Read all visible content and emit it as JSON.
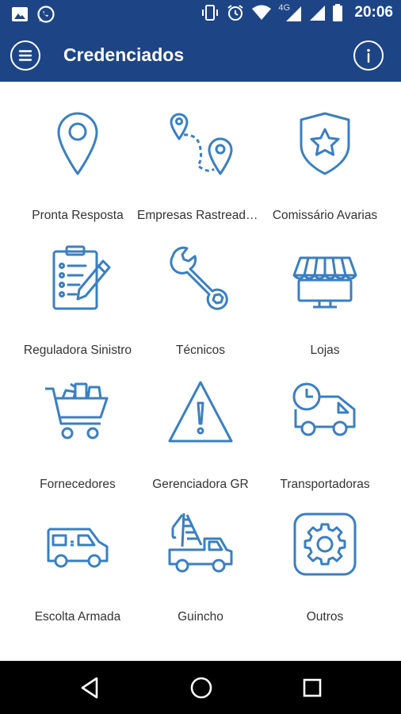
{
  "status_bar": {
    "time": "20:06",
    "network": "4G",
    "icons": [
      "image-notification-icon",
      "whatsapp-icon",
      "vibrate-icon",
      "alarm-icon",
      "wifi-icon",
      "signal-icon",
      "signal-icon",
      "battery-icon"
    ]
  },
  "app_bar": {
    "title": "Credenciados",
    "menu_icon": "hamburger-menu-icon",
    "info_icon": "info-icon",
    "background": "#1d4586"
  },
  "accent_color": "#3a7fc1",
  "tiles": [
    {
      "label": "Pronta Resposta",
      "icon": "map-pin-icon"
    },
    {
      "label": "Empresas Rastreadoras",
      "icon": "route-icon"
    },
    {
      "label": "Comissário Avarias",
      "icon": "shield-star-icon"
    },
    {
      "label": "Reguladora Sinistro",
      "icon": "clipboard-checklist-icon"
    },
    {
      "label": "Técnicos",
      "icon": "wrench-icon"
    },
    {
      "label": "Lojas",
      "icon": "storefront-icon"
    },
    {
      "label": "Fornecedores",
      "icon": "shopping-cart-icon"
    },
    {
      "label": "Gerenciadora GR",
      "icon": "warning-triangle-icon"
    },
    {
      "label": "Transportadoras",
      "icon": "delivery-truck-icon"
    },
    {
      "label": "Escolta Armada",
      "icon": "van-icon"
    },
    {
      "label": "Guincho",
      "icon": "tow-truck-icon"
    },
    {
      "label": "Outros",
      "icon": "gear-icon"
    }
  ],
  "nav_bar": {
    "back_icon": "back-triangle-icon",
    "home_icon": "home-circle-icon",
    "recents_icon": "recents-square-icon"
  }
}
